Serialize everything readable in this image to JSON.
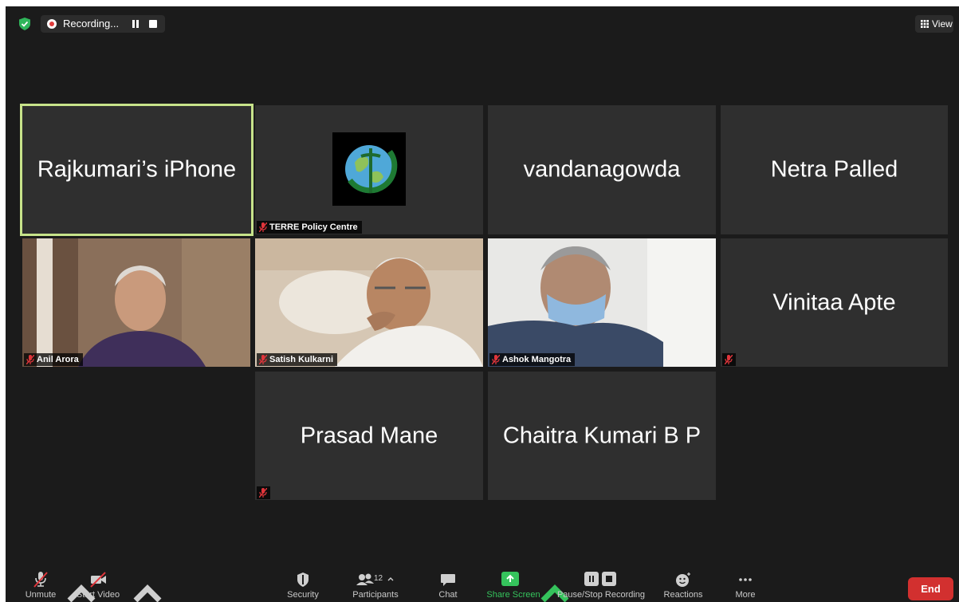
{
  "topbar": {
    "recording_label": "Recording...",
    "view_label": "View"
  },
  "tiles": {
    "rajkumari": {
      "name": "Rajkumari’s iPhone"
    },
    "terre": {
      "label": "TERRE Policy Centre"
    },
    "vandana": {
      "name": "vandanagowda"
    },
    "netra": {
      "name": "Netra Palled"
    },
    "anil": {
      "label": "Anil Arora"
    },
    "satish": {
      "label": "Satish Kulkarni"
    },
    "ashok": {
      "label": "Ashok Mangotra"
    },
    "vinitaa": {
      "name": "Vinitaa Apte"
    },
    "prasad": {
      "name": "Prasad Mane"
    },
    "chaitra": {
      "name": "Chaitra Kumari B P"
    }
  },
  "toolbar": {
    "unmute": "Unmute",
    "start_video": "Start Video",
    "security": "Security",
    "participants": "Participants",
    "participant_count": "12",
    "chat": "Chat",
    "share_screen": "Share Screen",
    "pause_stop_recording": "Pause/Stop Recording",
    "reactions": "Reactions",
    "more": "More",
    "end": "End"
  },
  "colors": {
    "background": "#1b1b1b",
    "tile": "#2f2f2f",
    "active_speaker_border": "#c7e38a",
    "share_green": "#35c35c",
    "end_red": "#d2302f",
    "muted_red": "#e0353b"
  }
}
